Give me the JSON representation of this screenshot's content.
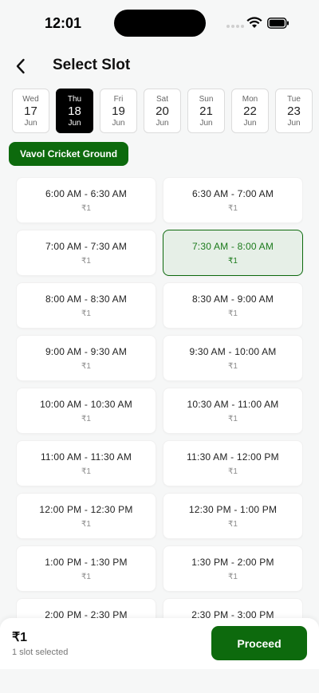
{
  "status_bar": {
    "time": "12:01"
  },
  "header": {
    "title": "Select Slot"
  },
  "dates": [
    {
      "dow": "Wed",
      "day": "17",
      "month": "Jun",
      "selected": false
    },
    {
      "dow": "Thu",
      "day": "18",
      "month": "Jun",
      "selected": true
    },
    {
      "dow": "Fri",
      "day": "19",
      "month": "Jun",
      "selected": false
    },
    {
      "dow": "Sat",
      "day": "20",
      "month": "Jun",
      "selected": false
    },
    {
      "dow": "Sun",
      "day": "21",
      "month": "Jun",
      "selected": false
    },
    {
      "dow": "Mon",
      "day": "22",
      "month": "Jun",
      "selected": false
    },
    {
      "dow": "Tue",
      "day": "23",
      "month": "Jun",
      "selected": false
    }
  ],
  "venue": {
    "name": "Vavol Cricket Ground"
  },
  "slots": [
    {
      "range": "6:00 AM - 6:30 AM",
      "price": "₹1",
      "selected": false
    },
    {
      "range": "6:30 AM - 7:00 AM",
      "price": "₹1",
      "selected": false
    },
    {
      "range": "7:00 AM - 7:30 AM",
      "price": "₹1",
      "selected": false
    },
    {
      "range": "7:30 AM - 8:00 AM",
      "price": "₹1",
      "selected": true
    },
    {
      "range": "8:00 AM - 8:30 AM",
      "price": "₹1",
      "selected": false
    },
    {
      "range": "8:30 AM - 9:00 AM",
      "price": "₹1",
      "selected": false
    },
    {
      "range": "9:00 AM - 9:30 AM",
      "price": "₹1",
      "selected": false
    },
    {
      "range": "9:30 AM - 10:00 AM",
      "price": "₹1",
      "selected": false
    },
    {
      "range": "10:00 AM - 10:30 AM",
      "price": "₹1",
      "selected": false
    },
    {
      "range": "10:30 AM - 11:00 AM",
      "price": "₹1",
      "selected": false
    },
    {
      "range": "11:00 AM - 11:30 AM",
      "price": "₹1",
      "selected": false
    },
    {
      "range": "11:30 AM - 12:00 PM",
      "price": "₹1",
      "selected": false
    },
    {
      "range": "12:00 PM - 12:30 PM",
      "price": "₹1",
      "selected": false
    },
    {
      "range": "12:30 PM - 1:00 PM",
      "price": "₹1",
      "selected": false
    },
    {
      "range": "1:00 PM - 1:30 PM",
      "price": "₹1",
      "selected": false
    },
    {
      "range": "1:30 PM - 2:00 PM",
      "price": "₹1",
      "selected": false
    },
    {
      "range": "2:00 PM - 2:30 PM",
      "price": "₹1",
      "selected": false
    },
    {
      "range": "2:30 PM - 3:00 PM",
      "price": "₹1",
      "selected": false
    }
  ],
  "footer": {
    "total": "₹1",
    "selected_text": "1 slot selected",
    "proceed_label": "Proceed"
  },
  "colors": {
    "accent": "#0d6a0d",
    "selected_slot_bg": "#e6efe7",
    "background": "#f6f7f7"
  },
  "icons": {
    "back": "chevron-left-icon",
    "wifi": "wifi-icon",
    "battery": "battery-icon"
  }
}
